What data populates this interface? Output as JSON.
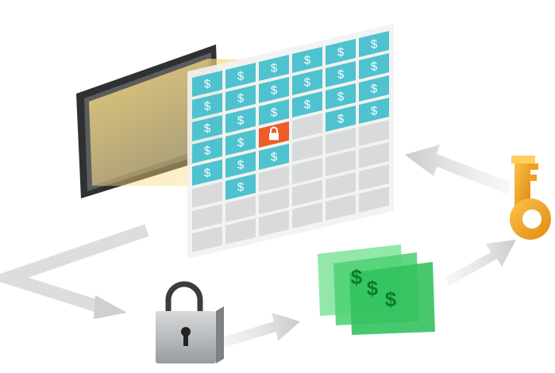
{
  "diagram": {
    "grid": {
      "rows": 8,
      "cols": 6,
      "cell_symbol": "$",
      "filled_rows_per_col": [
        5,
        6,
        5,
        3,
        4,
        4
      ],
      "locked_cell": {
        "col": 2,
        "row": 3
      }
    },
    "bills": {
      "symbols": [
        "$",
        "$",
        "$"
      ]
    },
    "colors": {
      "cell_teal": "#4fc2cf",
      "cell_empty": "#d9dadb",
      "cell_locked": "#ee5c2a",
      "screen_glow": "#f6d77a",
      "bill_green": "#3ecb63",
      "key_orange": "#f5a623",
      "padlock_gray": "#b9bcbf",
      "arrow_gray": "#d5d6d7"
    },
    "icons": [
      "monitor-icon",
      "database-grid-icon",
      "padlock-icon",
      "cash-bills-icon",
      "key-icon"
    ]
  }
}
